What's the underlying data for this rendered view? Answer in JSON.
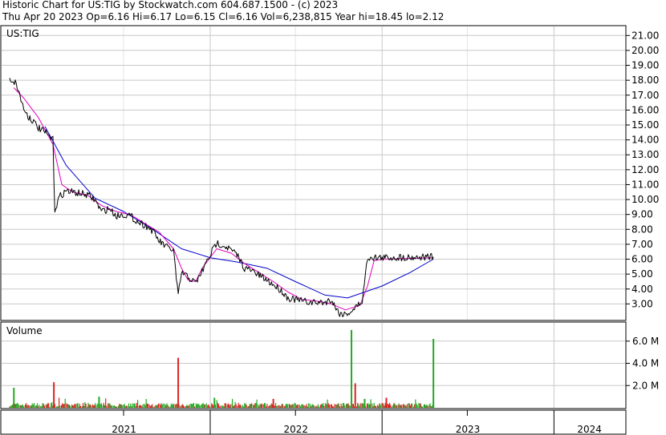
{
  "header": {
    "line1": "Historic Chart for US:TIG by Stockwatch.com 604.687.1500 - (c) 2023",
    "line2": "Thu Apr 20 2023  Op=6.16  Hi=6.17  Lo=6.15  Cl=6.16  Vol=6,238,815  Year hi=18.45  lo=2.12"
  },
  "colors": {
    "price": "#000000",
    "ma_short": "#e000c0",
    "ma_long": "#0000cc",
    "vol_up": "#22aa22",
    "vol_down": "#dd2222",
    "grid": "#c8c8c8"
  },
  "chart_data": [
    {
      "type": "line",
      "title": "US:TIG",
      "y_ticks": [
        "3.00",
        "4.00",
        "5.00",
        "6.00",
        "7.00",
        "8.00",
        "9.00",
        "10.00",
        "11.00",
        "12.00",
        "13.00",
        "14.00",
        "15.00",
        "16.00",
        "17.00",
        "18.00",
        "19.00",
        "20.00",
        "21.00"
      ],
      "ylim": [
        2.0,
        21.5
      ],
      "x_ticks": [
        "2021",
        "2022",
        "2023",
        "2024"
      ],
      "series": [
        {
          "role": "price",
          "x": [
            "2020-11-01",
            "2020-11-15",
            "2020-12-01",
            "2020-12-10",
            "2020-12-20",
            "2021-01-01",
            "2021-01-15",
            "2021-02-01",
            "2021-02-05",
            "2021-02-15",
            "2021-03-01",
            "2021-03-15",
            "2021-04-01",
            "2021-04-15",
            "2021-05-01",
            "2021-05-15",
            "2021-06-01",
            "2021-06-15",
            "2021-07-01",
            "2021-07-15",
            "2021-08-01",
            "2021-08-15",
            "2021-09-01",
            "2021-09-15",
            "2021-10-01",
            "2021-10-15",
            "2021-10-25",
            "2021-11-01",
            "2021-11-15",
            "2021-12-01",
            "2021-12-15",
            "2022-01-01",
            "2022-01-15",
            "2022-02-01",
            "2022-02-15",
            "2022-03-01",
            "2022-03-15",
            "2022-04-01",
            "2022-04-15",
            "2022-05-01",
            "2022-05-15",
            "2022-06-01",
            "2022-06-15",
            "2022-07-01",
            "2022-07-15",
            "2022-08-01",
            "2022-08-15",
            "2022-09-01",
            "2022-09-15",
            "2022-10-01",
            "2022-10-15",
            "2022-11-01",
            "2022-11-10",
            "2022-11-20",
            "2022-12-01",
            "2022-12-10",
            "2022-12-20",
            "2023-01-01",
            "2023-04-20"
          ],
          "values": [
            18.1,
            17.8,
            16.1,
            15.6,
            15.3,
            14.8,
            14.5,
            14.0,
            9.3,
            10.2,
            10.6,
            10.5,
            10.4,
            10.3,
            10.0,
            9.2,
            9.4,
            8.9,
            9.0,
            8.9,
            8.5,
            8.3,
            7.9,
            7.2,
            6.8,
            6.6,
            3.5,
            5.1,
            4.8,
            4.4,
            5.2,
            6.3,
            7.1,
            6.9,
            6.6,
            6.2,
            5.4,
            5.2,
            4.9,
            4.6,
            4.3,
            3.9,
            3.4,
            3.3,
            3.2,
            3.1,
            3.1,
            3.1,
            3.3,
            2.4,
            2.3,
            2.6,
            2.9,
            3.2,
            6.1,
            6.15,
            6.1,
            6.1,
            6.16
          ]
        },
        {
          "role": "ma_short",
          "x": [
            "2020-11-10",
            "2020-12-01",
            "2021-01-01",
            "2021-02-01",
            "2021-02-20",
            "2021-03-15",
            "2021-04-15",
            "2021-05-15",
            "2021-06-15",
            "2021-07-15",
            "2021-08-15",
            "2021-09-15",
            "2021-10-15",
            "2021-11-01",
            "2021-11-15",
            "2021-12-01",
            "2021-12-15",
            "2022-01-15",
            "2022-02-15",
            "2022-03-15",
            "2022-04-15",
            "2022-05-15",
            "2022-06-15",
            "2022-07-15",
            "2022-08-15",
            "2022-09-15",
            "2022-10-15",
            "2022-11-15",
            "2022-12-01",
            "2022-12-15",
            "2023-01-01",
            "2023-04-20"
          ],
          "values": [
            17.5,
            16.8,
            15.5,
            13.7,
            11.0,
            10.5,
            10.3,
            9.6,
            9.2,
            9.0,
            8.4,
            7.8,
            6.7,
            5.4,
            4.6,
            4.5,
            5.4,
            6.7,
            6.4,
            5.7,
            5.1,
            4.5,
            3.8,
            3.3,
            3.2,
            3.0,
            2.6,
            2.9,
            4.2,
            5.9,
            6.0,
            6.1
          ]
        },
        {
          "role": "ma_long",
          "x": [
            "2021-01-15",
            "2021-03-01",
            "2021-05-01",
            "2021-07-01",
            "2021-09-01",
            "2021-11-01",
            "2022-01-01",
            "2022-03-01",
            "2022-05-01",
            "2022-07-01",
            "2022-09-01",
            "2022-10-20",
            "2023-01-01",
            "2023-03-01",
            "2023-04-20"
          ],
          "values": [
            14.9,
            12.3,
            10.1,
            9.2,
            8.0,
            6.7,
            6.1,
            5.8,
            5.4,
            4.5,
            3.6,
            3.4,
            4.2,
            5.1,
            6.0
          ]
        }
      ]
    },
    {
      "type": "bar",
      "title": "Volume",
      "y_ticks": [
        "2.0 M",
        "4.0 M",
        "6.0 M"
      ],
      "ylim": [
        0,
        7.5
      ],
      "spikes": {
        "x": [
          "2020-11-10",
          "2021-02-03",
          "2021-05-10",
          "2021-10-25",
          "2022-01-10",
          "2022-05-15",
          "2022-10-28",
          "2022-11-05",
          "2022-11-25",
          "2023-01-10",
          "2023-04-20"
        ],
        "values": [
          1.8,
          2.3,
          1.0,
          4.5,
          0.9,
          0.8,
          7.0,
          2.2,
          0.8,
          0.9,
          6.2
        ]
      }
    }
  ]
}
